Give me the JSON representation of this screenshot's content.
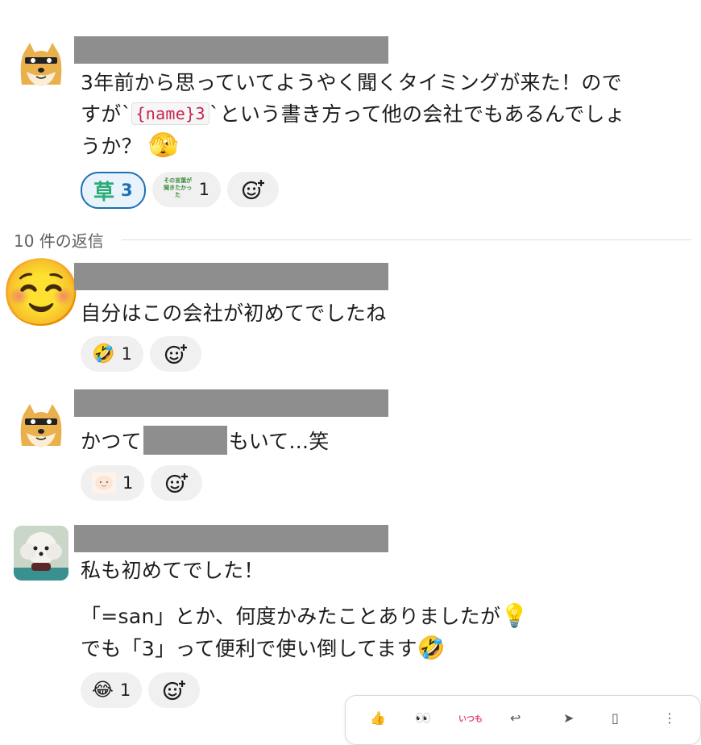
{
  "message1": {
    "text_line1": "3年前から思っていてようやく聞くタイミングが来た！ので",
    "text_line2_pre": "すが`",
    "code": "{name}3",
    "text_line2_post": "`という書き方って他の会社でもあるんでしょ",
    "text_line3": "うか？",
    "trailing_emoji": "🫣",
    "reactions": [
      {
        "emoji": "草",
        "count": "3",
        "active": true
      },
      {
        "emoji": "その言葉が聞きたかった",
        "count": "1",
        "active": false
      }
    ]
  },
  "thread": {
    "replies_label": "10 件の返信"
  },
  "reply1": {
    "avatar_emoji": "☺️",
    "text": "自分はこの会社が初めてでしたね",
    "reactions": [
      {
        "emoji": "🤣",
        "count": "1"
      }
    ]
  },
  "reply2": {
    "text_pre": "かつて",
    "text_post": "もいて...笑",
    "reactions": [
      {
        "emoji": "🙂",
        "count": "1"
      }
    ]
  },
  "reply3": {
    "text_line1": "私も初めてでした！",
    "text_line2": "「=san」とか、何度かみたことありましたが",
    "emoji_line2": "💡",
    "text_line3": "でも「3」って便利で使い倒してます",
    "emoji_line3": "🤣",
    "reactions": [
      {
        "emoji": "😂",
        "count": "1"
      }
    ]
  },
  "toolbar": {
    "itsumo_label": "いつも"
  },
  "colors": {
    "active_reaction_border": "#1d6fb5",
    "active_reaction_bg": "#e8f3fc",
    "reaction_bg": "#f0f0f0",
    "code_text": "#c7254e",
    "redaction": "#8e8e8e"
  }
}
